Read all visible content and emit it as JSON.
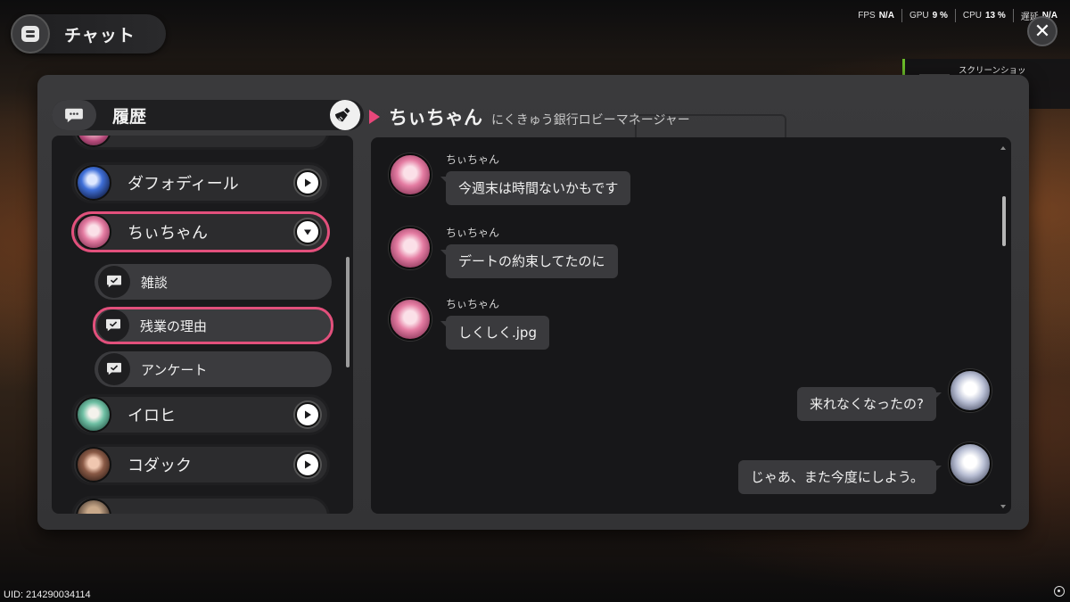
{
  "window": {
    "title": "チャット"
  },
  "stats": [
    {
      "label": "FPS",
      "value": "N/A"
    },
    {
      "label": "GPU",
      "value": "9 %"
    },
    {
      "label": "CPU",
      "value": "13 %"
    },
    {
      "label": "遅延",
      "value": "N/A"
    }
  ],
  "toast": {
    "text": "スクリーンショットが保存されました"
  },
  "history": {
    "title": "履歴"
  },
  "contacts": [
    {
      "name": "ダフォディール"
    },
    {
      "name": "ちぃちゃん"
    },
    {
      "name": "イロヒ"
    },
    {
      "name": "コダック"
    }
  ],
  "topics": [
    {
      "label": "雑談"
    },
    {
      "label": "残業の理由"
    },
    {
      "label": "アンケート"
    }
  ],
  "chat": {
    "name": "ちぃちゃん",
    "subtitle": "にくきゅう銀行ロビーマネージャー",
    "messages": [
      {
        "sender": "ちぃちゃん",
        "text": "今週末は時間ないかもです",
        "direction": "in"
      },
      {
        "sender": "ちぃちゃん",
        "text": "デートの約束してたのに",
        "direction": "in"
      },
      {
        "sender": "ちぃちゃん",
        "text": "しくしく.jpg",
        "direction": "in"
      },
      {
        "sender": "",
        "text": "来れなくなったの?",
        "direction": "out"
      },
      {
        "sender": "",
        "text": "じゃあ、また今度にしよう。",
        "direction": "out"
      }
    ]
  },
  "footer": {
    "uid": "UID: 214290034114"
  },
  "colors": {
    "accent": "#e2507c",
    "toast_bar": "#6bbd2a",
    "bubble": "#3a3a3d"
  }
}
